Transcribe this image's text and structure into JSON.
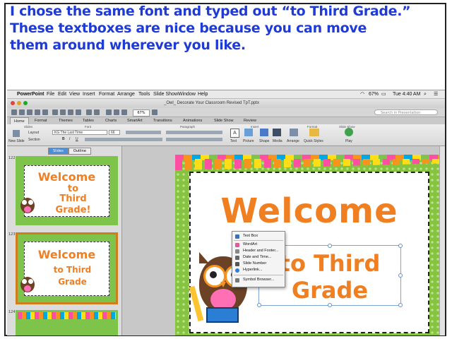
{
  "caption": {
    "line1": "I chose the same font and typed out “to Third Grade.”",
    "line2": "These textboxes are nice because you can move",
    "line3": "them around wherever you like."
  },
  "menubar": {
    "apple": "",
    "app": "PowerPoint",
    "items": [
      "File",
      "Edit",
      "View",
      "Insert",
      "Format",
      "Arrange",
      "Tools",
      "Slide Show",
      "Window",
      "Help"
    ],
    "battery": "67%",
    "time": "Tue 4:40 AM"
  },
  "window": {
    "title": "_Owl_ Decorate Your Classroom Revised TpT.pptx"
  },
  "toolbar": {
    "zoom": "67%",
    "search_placeholder": "Search in Presentation"
  },
  "ribbon_tabs": [
    "Home",
    "Format",
    "Themes",
    "Tables",
    "Charts",
    "SmartArt",
    "Transitions",
    "Animations",
    "Slide Show",
    "Review"
  ],
  "active_tab": "Home",
  "ribbon": {
    "groups": [
      "Slides",
      "Font",
      "Paragraph",
      "Insert",
      "Format",
      "Slide Show"
    ],
    "new_slide_label": "New Slide",
    "layout_label": "Layout",
    "section_label": "Section",
    "font_name": "KG The Last Time",
    "font_size": "66",
    "insert_buttons": [
      "Text",
      "Picture",
      "Shape",
      "Media"
    ],
    "arrange_label": "Arrange",
    "quick_styles_label": "Quick Styles",
    "play_label": "Play"
  },
  "view_tabs": [
    "Slides",
    "Outline"
  ],
  "thumbnails": [
    {
      "number": "122",
      "lines": [
        "Welcome",
        "to",
        "Third",
        "Grade!"
      ],
      "selected": false
    },
    {
      "number": "123",
      "lines": [
        "Welcome",
        "to Third",
        "Grade"
      ],
      "selected": true
    },
    {
      "number": "124",
      "lines": [],
      "selected": false
    }
  ],
  "slide": {
    "title": "Welcome",
    "textbox_line1": "to Third",
    "textbox_line2": "Grade"
  },
  "dropdown": {
    "items": [
      "Text Box",
      "WordArt",
      "Header and Footer...",
      "Date and Time...",
      "Slide Number",
      "Hyperlink...",
      "Symbol Browser..."
    ]
  },
  "colors": {
    "caption": "#1f3bd6",
    "slide_text": "#f07f22",
    "slide_bg": "#86c440",
    "selected_thumb_border": "#d07d1e"
  }
}
